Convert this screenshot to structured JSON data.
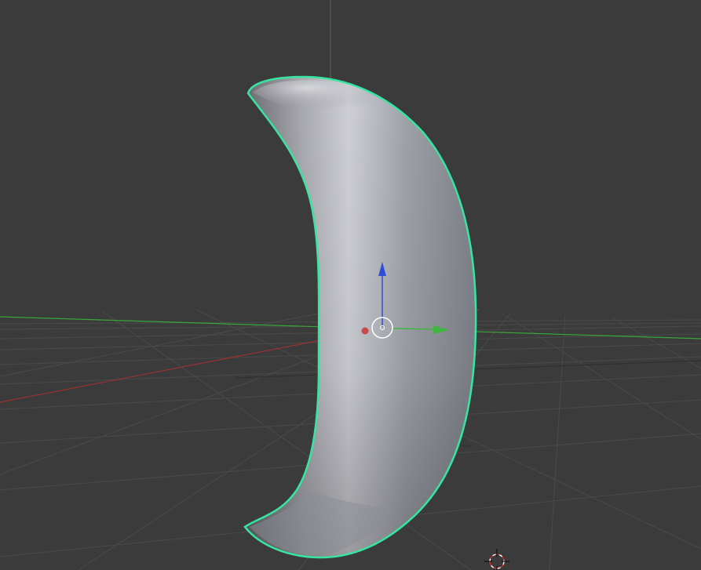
{
  "app": {
    "view": "3d-viewport",
    "background_color": "#3b3b3b"
  },
  "scene": {
    "selected_object": "curved-crescent-mesh",
    "selection_outline_color": "#36e6a0",
    "axis_colors": {
      "x": "#b03a3a",
      "y": "#3fb63f",
      "z": "#2f4fd6"
    },
    "gizmo": {
      "type": "translate",
      "icons": [
        "x-handle-dot",
        "y-arrow",
        "z-arrow",
        "pivot-ring"
      ]
    },
    "cursor_3d": "crosshair-target-icon"
  }
}
